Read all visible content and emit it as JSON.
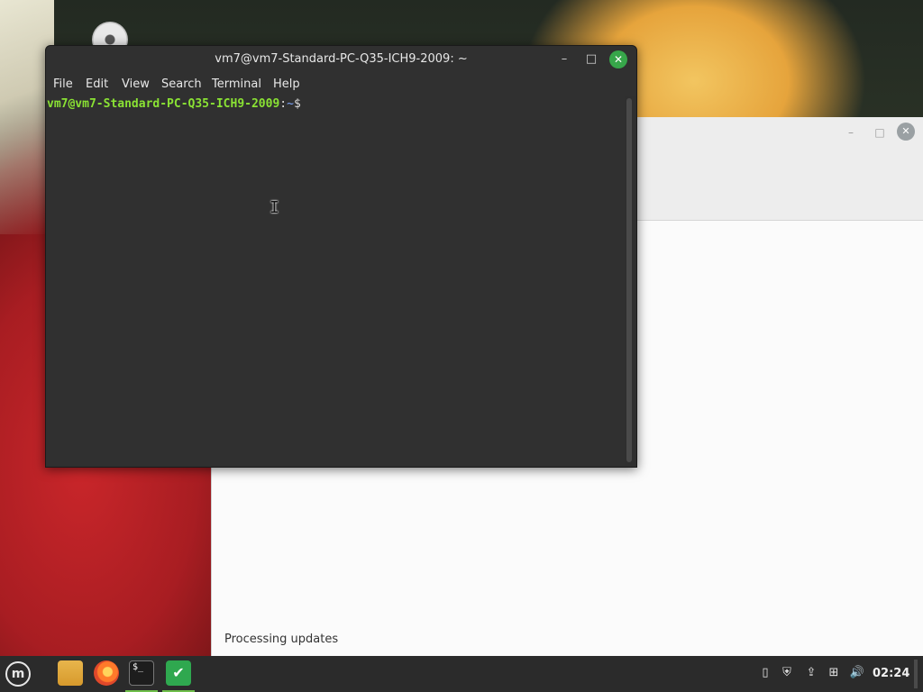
{
  "terminal": {
    "title": "vm7@vm7-Standard-PC-Q35-ICH9-2009: ~",
    "menu": [
      "File",
      "Edit",
      "View",
      "Search",
      "Terminal",
      "Help"
    ],
    "prompt": {
      "user_host": "vm7@vm7-Standard-PC-Q35-ICH9-2009",
      "separator": ":",
      "path": "~",
      "symbol": "$"
    },
    "controls": {
      "minimize": "–",
      "maximize": "□",
      "close": "✕"
    }
  },
  "background_window": {
    "status_text": "Processing updates",
    "controls": {
      "minimize": "–",
      "maximize": "□",
      "close": "✕"
    }
  },
  "taskbar": {
    "menu_glyph": "m",
    "terminal_glyph": "$_",
    "shield_glyph": "✔",
    "tray": {
      "clipboard_glyph": "▯",
      "shield_glyph": "⛨",
      "update_glyph": "⇪",
      "network_glyph": "⊞",
      "volume_glyph": "🔊"
    },
    "clock": "02:24"
  },
  "colors": {
    "prompt_user": "#8ae234",
    "prompt_path": "#7fa7ff",
    "terminal_bg": "#303030",
    "close_green": "#37a64a",
    "taskbar_bg": "#2b2b2b"
  }
}
